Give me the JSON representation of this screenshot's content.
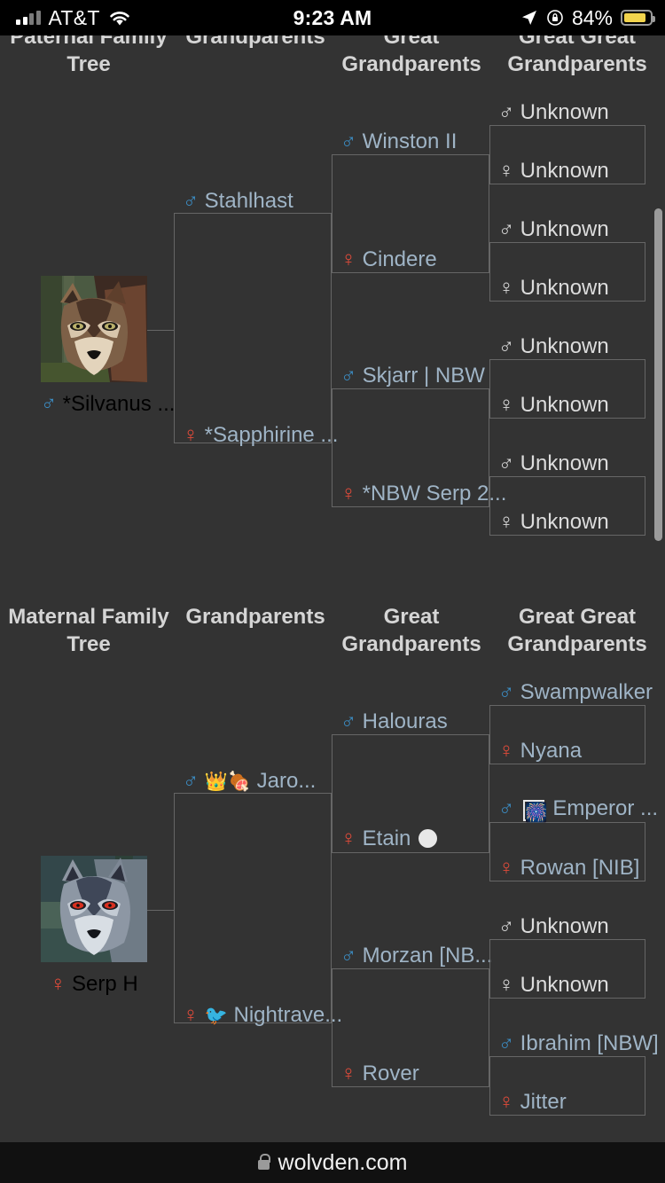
{
  "status_bar": {
    "carrier": "AT&T",
    "time": "9:23 AM",
    "battery_percent": "84%",
    "icons": [
      "signal-bars-icon",
      "wifi-icon",
      "location-arrow-icon",
      "rotation-lock-icon",
      "battery-icon"
    ],
    "battery_color": "#f2d44d"
  },
  "browser": {
    "url": "wolvden.com",
    "lock_icon": "lock-icon"
  },
  "colors": {
    "background": "#333333",
    "link": "#9fb4c6",
    "male_symbol": "#3c8dc4",
    "female_symbol": "#e04b3a",
    "border": "#666666",
    "header_text": "#d5d5d5"
  },
  "paternal": {
    "headers": [
      "Paternal Family Tree",
      "Grandparents",
      "Great Grandparents",
      "Great Great Grandparents"
    ],
    "subject": {
      "name": "*Silvanus ...",
      "sex": "male",
      "symbol": "♂",
      "avatar": "wolf-portrait-brown"
    },
    "grandparents": [
      {
        "name": "Stahlhast",
        "sex": "male",
        "symbol": "♂"
      },
      {
        "name": "*Sapphirine ...",
        "sex": "female",
        "symbol": "♀"
      }
    ],
    "great_grandparents": [
      {
        "name": "Winston II",
        "sex": "male",
        "symbol": "♂"
      },
      {
        "name": "Cindere",
        "sex": "female",
        "symbol": "♀"
      },
      {
        "name": "Skjarr | NBW",
        "sex": "male",
        "symbol": "♂"
      },
      {
        "name": "*NBW Serp 2...",
        "sex": "female",
        "symbol": "♀"
      }
    ],
    "great_great_grandparents": [
      {
        "name": "Unknown",
        "sex": "male",
        "symbol": "♂",
        "known": false
      },
      {
        "name": "Unknown",
        "sex": "female",
        "symbol": "♀",
        "known": false
      },
      {
        "name": "Unknown",
        "sex": "male",
        "symbol": "♂",
        "known": false
      },
      {
        "name": "Unknown",
        "sex": "female",
        "symbol": "♀",
        "known": false
      },
      {
        "name": "Unknown",
        "sex": "male",
        "symbol": "♂",
        "known": false
      },
      {
        "name": "Unknown",
        "sex": "female",
        "symbol": "♀",
        "known": false
      },
      {
        "name": "Unknown",
        "sex": "male",
        "symbol": "♂",
        "known": false
      },
      {
        "name": "Unknown",
        "sex": "female",
        "symbol": "♀",
        "known": false
      }
    ]
  },
  "maternal": {
    "headers": [
      "Maternal Family Tree",
      "Grandparents",
      "Great Grandparents",
      "Great Great Grandparents"
    ],
    "subject": {
      "name": "Serp H",
      "sex": "female",
      "symbol": "♀",
      "avatar": "wolf-portrait-grey"
    },
    "grandparents": [
      {
        "name": "Jaro...",
        "sex": "male",
        "symbol": "♂",
        "decor": [
          "👑",
          "🍖"
        ]
      },
      {
        "name": "Nightrave...",
        "sex": "female",
        "symbol": "♀",
        "decor": [
          "🐦"
        ]
      }
    ],
    "great_grandparents": [
      {
        "name": "Halouras",
        "sex": "male",
        "symbol": "♂"
      },
      {
        "name": "Etain",
        "sex": "female",
        "symbol": "♀",
        "decor_after": "white-circle"
      },
      {
        "name": "Morzan [NB...",
        "sex": "male",
        "symbol": "♂"
      },
      {
        "name": "Rover",
        "sex": "female",
        "symbol": "♀"
      }
    ],
    "great_great_grandparents": [
      {
        "name": "Swampwalker",
        "sex": "male",
        "symbol": "♂",
        "known": true
      },
      {
        "name": "Nyana",
        "sex": "female",
        "symbol": "♀",
        "known": true
      },
      {
        "name": "Emperor ...",
        "sex": "male",
        "symbol": "♂",
        "known": true,
        "decor_box": "🎆"
      },
      {
        "name": "Rowan [NIB]",
        "sex": "female",
        "symbol": "♀",
        "known": true
      },
      {
        "name": "Unknown",
        "sex": "male",
        "symbol": "♂",
        "known": false
      },
      {
        "name": "Unknown",
        "sex": "female",
        "symbol": "♀",
        "known": false
      },
      {
        "name": "Ibrahim [NBW]",
        "sex": "male",
        "symbol": "♂",
        "known": true
      },
      {
        "name": "Jitter",
        "sex": "female",
        "symbol": "♀",
        "known": true
      }
    ]
  }
}
